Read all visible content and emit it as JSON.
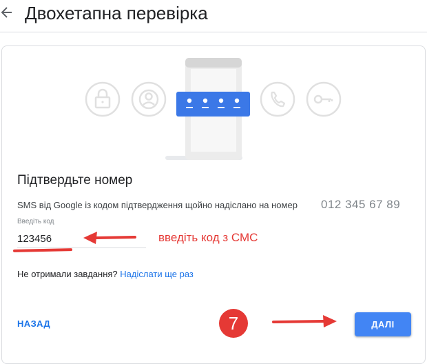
{
  "header": {
    "title": "Двохетапна перевірка",
    "back_icon": "arrow-left-icon"
  },
  "illustration": {
    "icons": [
      "lock-icon",
      "person-icon",
      "phone-call-icon",
      "key-icon"
    ],
    "code_dots": 4,
    "accent_color": "#3b78e7"
  },
  "verify": {
    "heading": "Підтвердьте номер",
    "description": "SMS від Google із кодом підтвердження щойно надіслано на номер",
    "phone_number": "012 345 67 89",
    "code_label": "Введіть код",
    "code_value": "123456"
  },
  "resend": {
    "question": "Не отримали завдання?",
    "link": "Надіслати ще раз"
  },
  "actions": {
    "back_label": "НАЗАД",
    "next_label": "ДАЛІ"
  },
  "annotations": {
    "hint_text": "введіть код з СМС",
    "step_number": "7",
    "color": "#e53935"
  }
}
